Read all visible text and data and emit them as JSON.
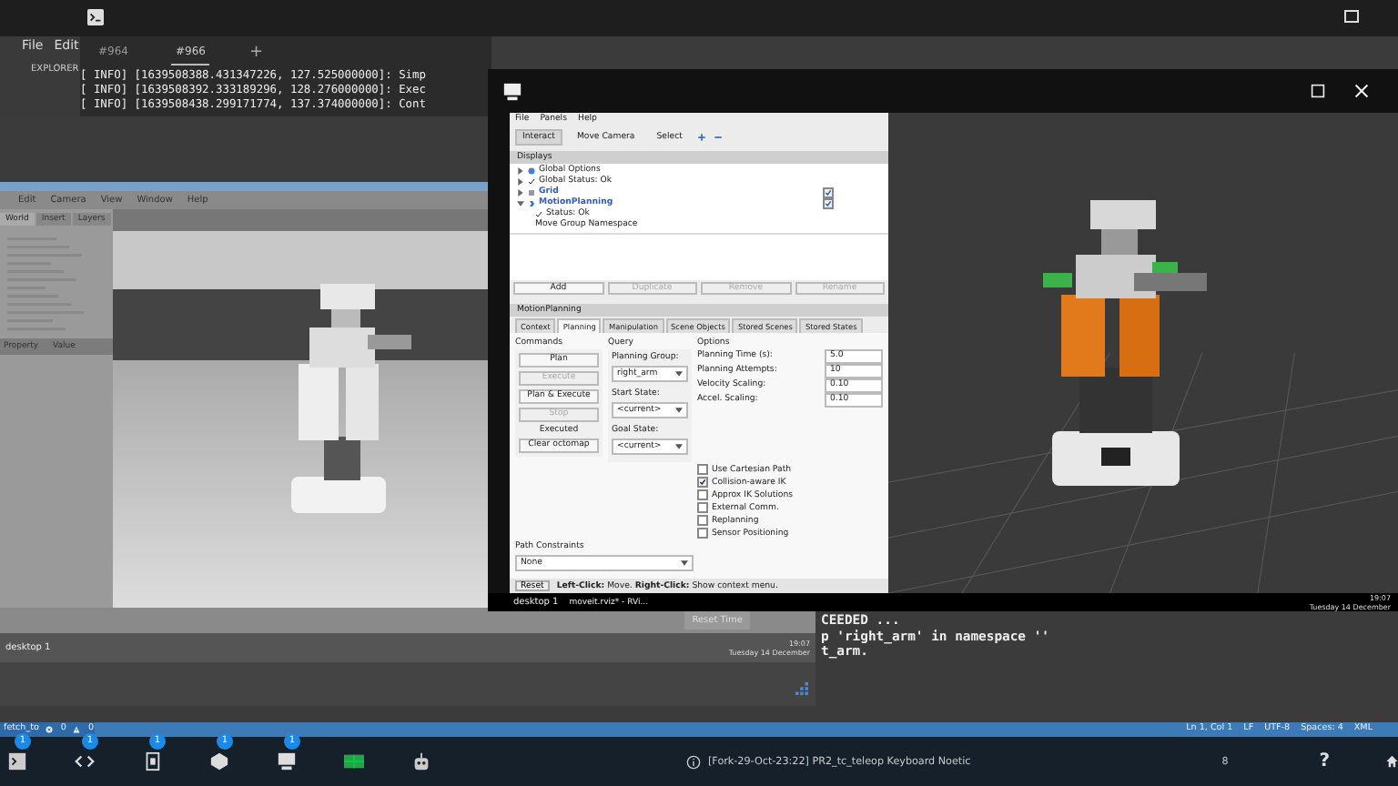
{
  "vscode": {
    "menu": [
      "File",
      "Edit"
    ],
    "explorer_label": "EXPLORER"
  },
  "terminal": {
    "tabs": [
      {
        "label": "#964",
        "selected": false
      },
      {
        "label": "#966",
        "selected": true
      }
    ],
    "new_tab": "+",
    "lines": [
      "[ INFO] [1639508388.431347226, 127.525000000]: Simp",
      "[ INFO] [1639508392.333189296, 128.276000000]: Exec",
      "[ INFO] [1639508438.299171774, 137.374000000]: Cont"
    ],
    "lower_lines": [
      "CEEDED ...",
      "p 'right_arm' in namespace ''",
      "t_arm."
    ]
  },
  "gazebo": {
    "menu": [
      "Edit",
      "Camera",
      "View",
      "Window",
      "Help"
    ],
    "tabs": [
      {
        "label": "World",
        "selected": true
      },
      {
        "label": "Insert",
        "selected": false
      },
      {
        "label": "Layers",
        "selected": false
      }
    ],
    "property_columns": [
      "Property",
      "Value"
    ],
    "reset_button": "Reset Time",
    "desktop_label": "desktop 1",
    "clock_time": "19:07",
    "clock_date": "Tuesday 14 December"
  },
  "rviz": {
    "menu": [
      "File",
      "Panels",
      "Help"
    ],
    "tools": [
      {
        "label": "Interact",
        "selected": true
      },
      {
        "label": "Move Camera",
        "selected": false
      },
      {
        "label": "Select",
        "selected": false
      }
    ],
    "displays_title": "Displays",
    "displays": [
      {
        "label": "Global Options",
        "kind": "options"
      },
      {
        "label": "Global Status: Ok",
        "kind": "status"
      },
      {
        "label": "Grid",
        "kind": "grid",
        "checked": true
      },
      {
        "label": "MotionPlanning",
        "kind": "plugin",
        "checked": true,
        "expanded": true,
        "children": [
          {
            "label": "Status: Ok",
            "kind": "status"
          },
          {
            "label": "Move Group Namespace",
            "kind": "field"
          }
        ]
      }
    ],
    "display_buttons": [
      {
        "label": "Add",
        "disabled": false
      },
      {
        "label": "Duplicate",
        "disabled": true
      },
      {
        "label": "Remove",
        "disabled": true
      },
      {
        "label": "Rename",
        "disabled": true
      }
    ],
    "panel_title": "MotionPlanning",
    "tabs": [
      {
        "label": "Context",
        "selected": false
      },
      {
        "label": "Planning",
        "selected": true
      },
      {
        "label": "Manipulation",
        "selected": false
      },
      {
        "label": "Scene Objects",
        "selected": false
      },
      {
        "label": "Stored Scenes",
        "selected": false
      },
      {
        "label": "Stored States",
        "selected": false
      }
    ],
    "commands_title": "Commands",
    "commands": [
      {
        "label": "Plan",
        "disabled": false
      },
      {
        "label": "Execute",
        "disabled": true
      },
      {
        "label": "Plan & Execute",
        "disabled": false
      },
      {
        "label": "Stop",
        "disabled": true
      }
    ],
    "command_status": "Executed",
    "clear_button": "Clear octomap",
    "query_title": "Query",
    "query": [
      {
        "label": "Planning Group:",
        "value": "right_arm"
      },
      {
        "label": "Start State:",
        "value": "<current>"
      },
      {
        "label": "Goal State:",
        "value": "<current>"
      }
    ],
    "options_title": "Options",
    "options": [
      {
        "label": "Planning Time (s):",
        "value": "5.0"
      },
      {
        "label": "Planning Attempts:",
        "value": "10"
      },
      {
        "label": "Velocity Scaling:",
        "value": "0.10"
      },
      {
        "label": "Accel. Scaling:",
        "value": "0.10"
      }
    ],
    "checks": [
      {
        "label": "Use Cartesian Path",
        "checked": false
      },
      {
        "label": "Collision-aware IK",
        "checked": true
      },
      {
        "label": "Approx IK Solutions",
        "checked": false
      },
      {
        "label": "External Comm.",
        "checked": false
      },
      {
        "label": "Replanning",
        "checked": false
      },
      {
        "label": "Sensor Positioning",
        "checked": false
      }
    ],
    "path_constraints_label": "Path Constraints",
    "path_constraints_value": "None",
    "reset_button": "Reset",
    "status_text": "**Left-Click:** Move. **Right-Click:** Show context menu.",
    "desktop_label": "desktop 1",
    "task_label": "moveit.rviz* - RVi...",
    "clock_time": "19:07",
    "clock_date": "Tuesday 14 December"
  },
  "status_bar": {
    "branch": "fetch_to",
    "errors": "0",
    "warnings": "0",
    "right": [
      "Ln 1, Col 1",
      "LF",
      "UTF-8",
      "Spaces: 4",
      "XML"
    ]
  },
  "taskbar": {
    "apps": [
      {
        "kind": "terminal",
        "badge": "1"
      },
      {
        "kind": "code",
        "badge": "1"
      },
      {
        "kind": "document",
        "badge": "1"
      },
      {
        "kind": "package",
        "badge": "1"
      },
      {
        "kind": "computer",
        "badge": "1"
      },
      {
        "kind": "grid"
      },
      {
        "kind": "robot"
      }
    ],
    "notification": "[Fork-29-Oct-23:22] PR2_tc_teleop Keyboard Noetic",
    "count": "8",
    "help": "?"
  }
}
